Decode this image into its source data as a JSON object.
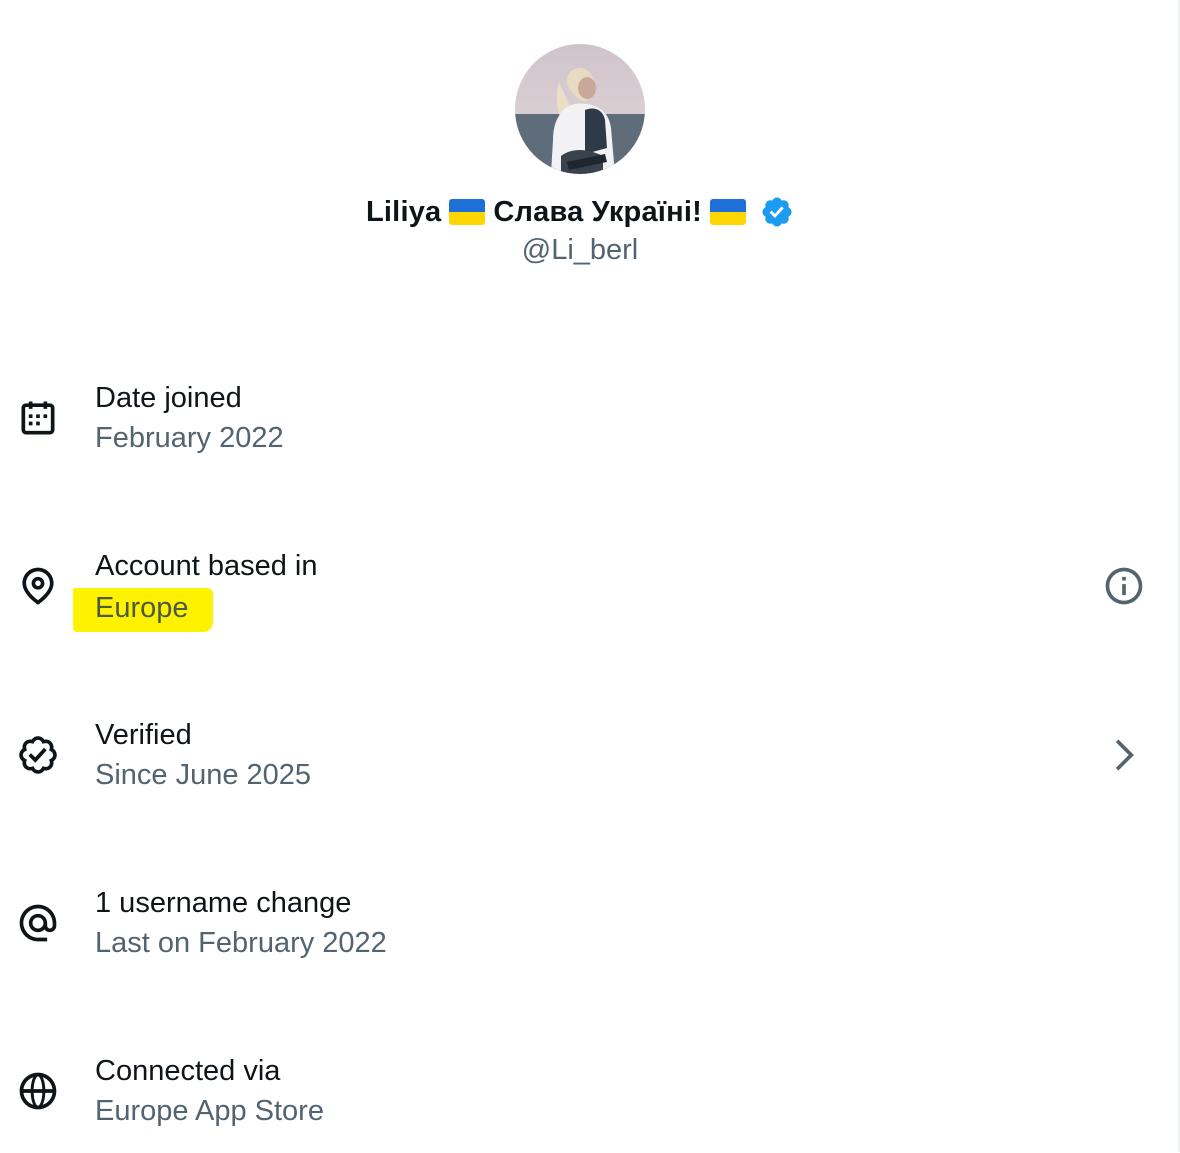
{
  "profile": {
    "name_part1": "Liliya",
    "name_part2": "Слава Україні!",
    "handle": "@Li_berl",
    "flag_emoji": "ukraine-flag",
    "verified_color": "#1d9bf0"
  },
  "rows": {
    "date_joined": {
      "label": "Date joined",
      "value": "February 2022",
      "icon": "calendar-icon"
    },
    "account_based": {
      "label": "Account based in",
      "value": "Europe",
      "icon": "location-pin-icon",
      "trailing_icon": "info-icon",
      "highlight_color": "#fff200"
    },
    "verified": {
      "label": "Verified",
      "value": "Since June 2025",
      "icon": "verified-badge-outline-icon",
      "trailing_icon": "chevron-right-icon"
    },
    "username_change": {
      "label": "1 username change",
      "value": "Last on February 2022",
      "icon": "at-sign-icon"
    },
    "connected_via": {
      "label": "Connected via",
      "value": "Europe App Store",
      "icon": "globe-icon"
    }
  },
  "colors": {
    "primary_text": "#0f1419",
    "secondary_text": "#536471",
    "accent": "#1d9bf0"
  }
}
